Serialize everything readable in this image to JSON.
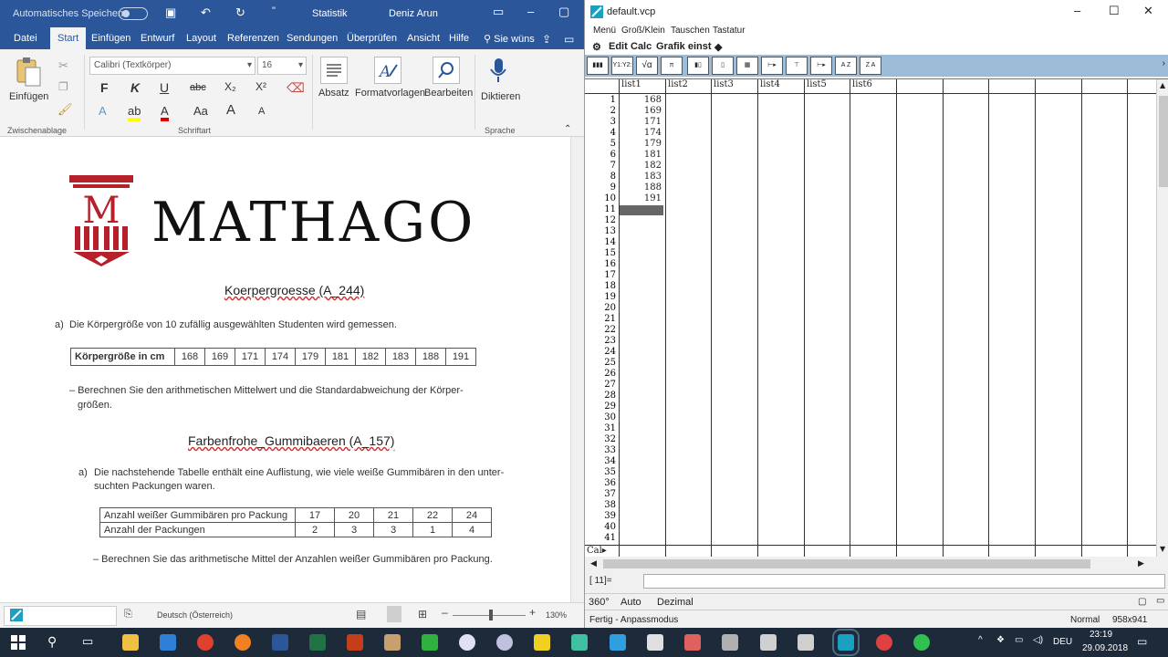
{
  "word": {
    "autosave_label": "Automatisches Speichern",
    "doc_title": "Statistik",
    "user_name": "Deniz Arun",
    "tabs": [
      "Datei",
      "Start",
      "Einfügen",
      "Entwurf",
      "Layout",
      "Referenzen",
      "Sendungen",
      "Überprüfen",
      "Ansicht",
      "Hilfe"
    ],
    "tell_me": "Sie wüns",
    "ribbon": {
      "paste_label": "Einfügen",
      "font_name": "Calibri (Textkörper)",
      "font_size": "16",
      "groups": [
        "Zwischenablage",
        "Schriftart",
        "Sprache"
      ],
      "absatz": "Absatz",
      "formatvorlagen": "Formatvorlagen",
      "bearbeiten": "Bearbeiten",
      "diktieren": "Diktieren",
      "bold": "F",
      "italic": "K",
      "underline": "U",
      "strike": "abc",
      "sub": "X₂",
      "sup": "X²",
      "case": "Aa",
      "grow": "A",
      "shrink": "A"
    },
    "doc": {
      "logo_text": "MATHAGO",
      "logo_mark": "M",
      "title1": "Koerpergroesse (A_244)",
      "part_a": "a)",
      "intro1": "Die Körpergröße von 10 zufällig ausgewählten Studenten wird gemessen.",
      "table1_header": "Körpergröße in cm",
      "table1_values": [
        "168",
        "169",
        "171",
        "174",
        "179",
        "181",
        "182",
        "183",
        "188",
        "191"
      ],
      "task1_line1": "– Berechnen Sie den arithmetischen Mittelwert und die Standardabweichung der Körper-",
      "task1_line2": "größen.",
      "title2": "Farbenfrohe_Gummibaeren (A_157)",
      "intro2_line1": "Die nachstehende Tabelle enthält eine Auflistung, wie viele weiße Gummibären in den unter-",
      "intro2_line2": "suchten Packungen waren.",
      "table2_row1_label": "Anzahl weißer Gummibären pro Packung",
      "table2_row1": [
        "17",
        "20",
        "21",
        "22",
        "24"
      ],
      "table2_row2_label": "Anzahl der Packungen",
      "table2_row2": [
        "2",
        "3",
        "3",
        "1",
        "4"
      ],
      "task2": "– Berechnen Sie das arithmetische Mittel der Anzahlen weißer Gummibären pro Packung."
    },
    "status": {
      "language": "Deutsch (Österreich)",
      "zoom": "130%"
    }
  },
  "cas": {
    "window_title": "default.vcp",
    "menu": [
      "Menü",
      "Groß/Klein",
      "Tauschen",
      "Tastatur"
    ],
    "bar": [
      "Edit",
      "Calc",
      "Grafik einst"
    ],
    "tools": [
      "▮▮▮",
      "Y1:Y2:",
      "√α",
      "π 3.141",
      "▮▯",
      "▯",
      "▦",
      "⊢▸",
      "⊤",
      "⊢▸",
      "A Z",
      "Z A"
    ],
    "columns": [
      "list1",
      "list2",
      "list3",
      "list4",
      "list5",
      "list6"
    ],
    "rows": [
      "1",
      "2",
      "3",
      "4",
      "5",
      "6",
      "7",
      "8",
      "9",
      "10",
      "11",
      "12",
      "13",
      "14",
      "15",
      "16",
      "17",
      "18",
      "19",
      "20",
      "21",
      "22",
      "23",
      "24",
      "25",
      "26",
      "27",
      "28",
      "29",
      "30",
      "31",
      "32",
      "33",
      "34",
      "35",
      "36",
      "37",
      "38",
      "39",
      "40",
      "41"
    ],
    "list1": [
      "168",
      "169",
      "171",
      "174",
      "179",
      "181",
      "182",
      "183",
      "188",
      "191"
    ],
    "cal_label": "Cal▸",
    "input_label": "[ 11]=",
    "mode": {
      "angle": "360°",
      "auto": "Auto",
      "dezimal": "Dezimal"
    },
    "status": {
      "left": "Fertig - Anpassmodus",
      "normal": "Normal",
      "size": "958x941"
    }
  },
  "taskbar": {
    "lang": "DEU",
    "time": "23:19",
    "date": "29.09.2018"
  },
  "colors": {
    "word_blue": "#2b579a",
    "cas_toolbar": "#9dbcd8",
    "logo_red": "#b5202a"
  }
}
